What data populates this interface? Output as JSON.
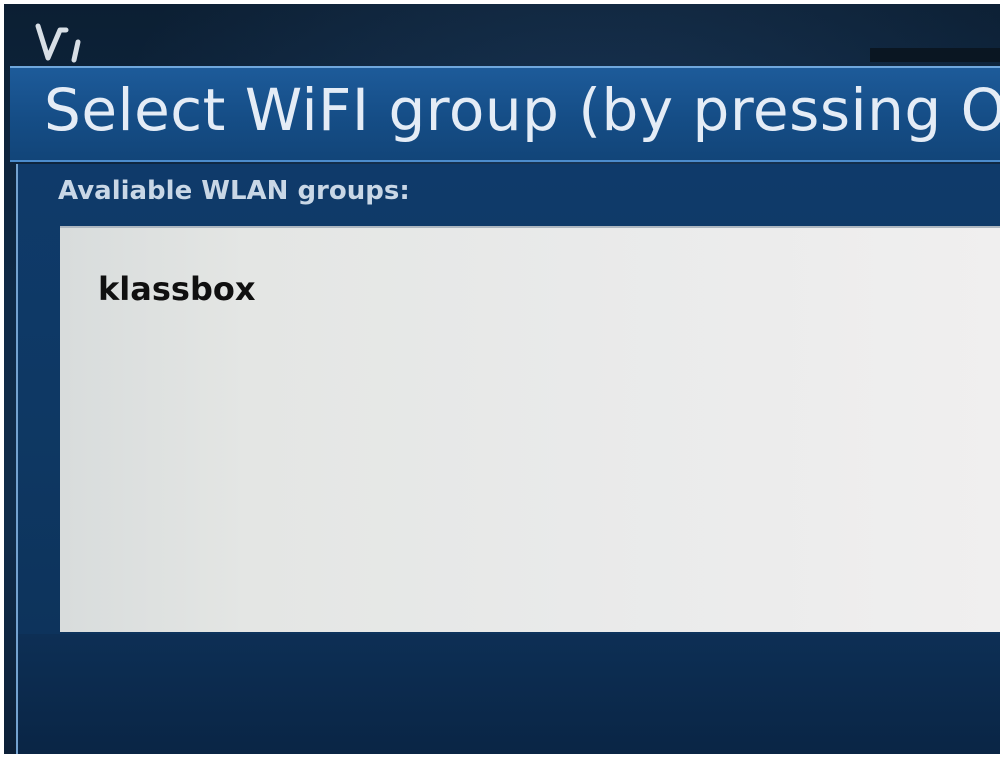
{
  "dialog": {
    "title": "Select WiFI group (by pressing OK",
    "groups_label": "Avaliable WLAN groups:"
  },
  "wlan_groups": [
    {
      "name": "klassbox"
    }
  ],
  "icons": {
    "top_mark": "logo-mark-icon"
  },
  "colors": {
    "title_bar": "#1a5594",
    "panel": "#0f3a6a",
    "list_background": "#e6e8e7",
    "title_text": "#e4ecf6",
    "label_text": "#c9d7e6",
    "item_text": "#101010"
  }
}
